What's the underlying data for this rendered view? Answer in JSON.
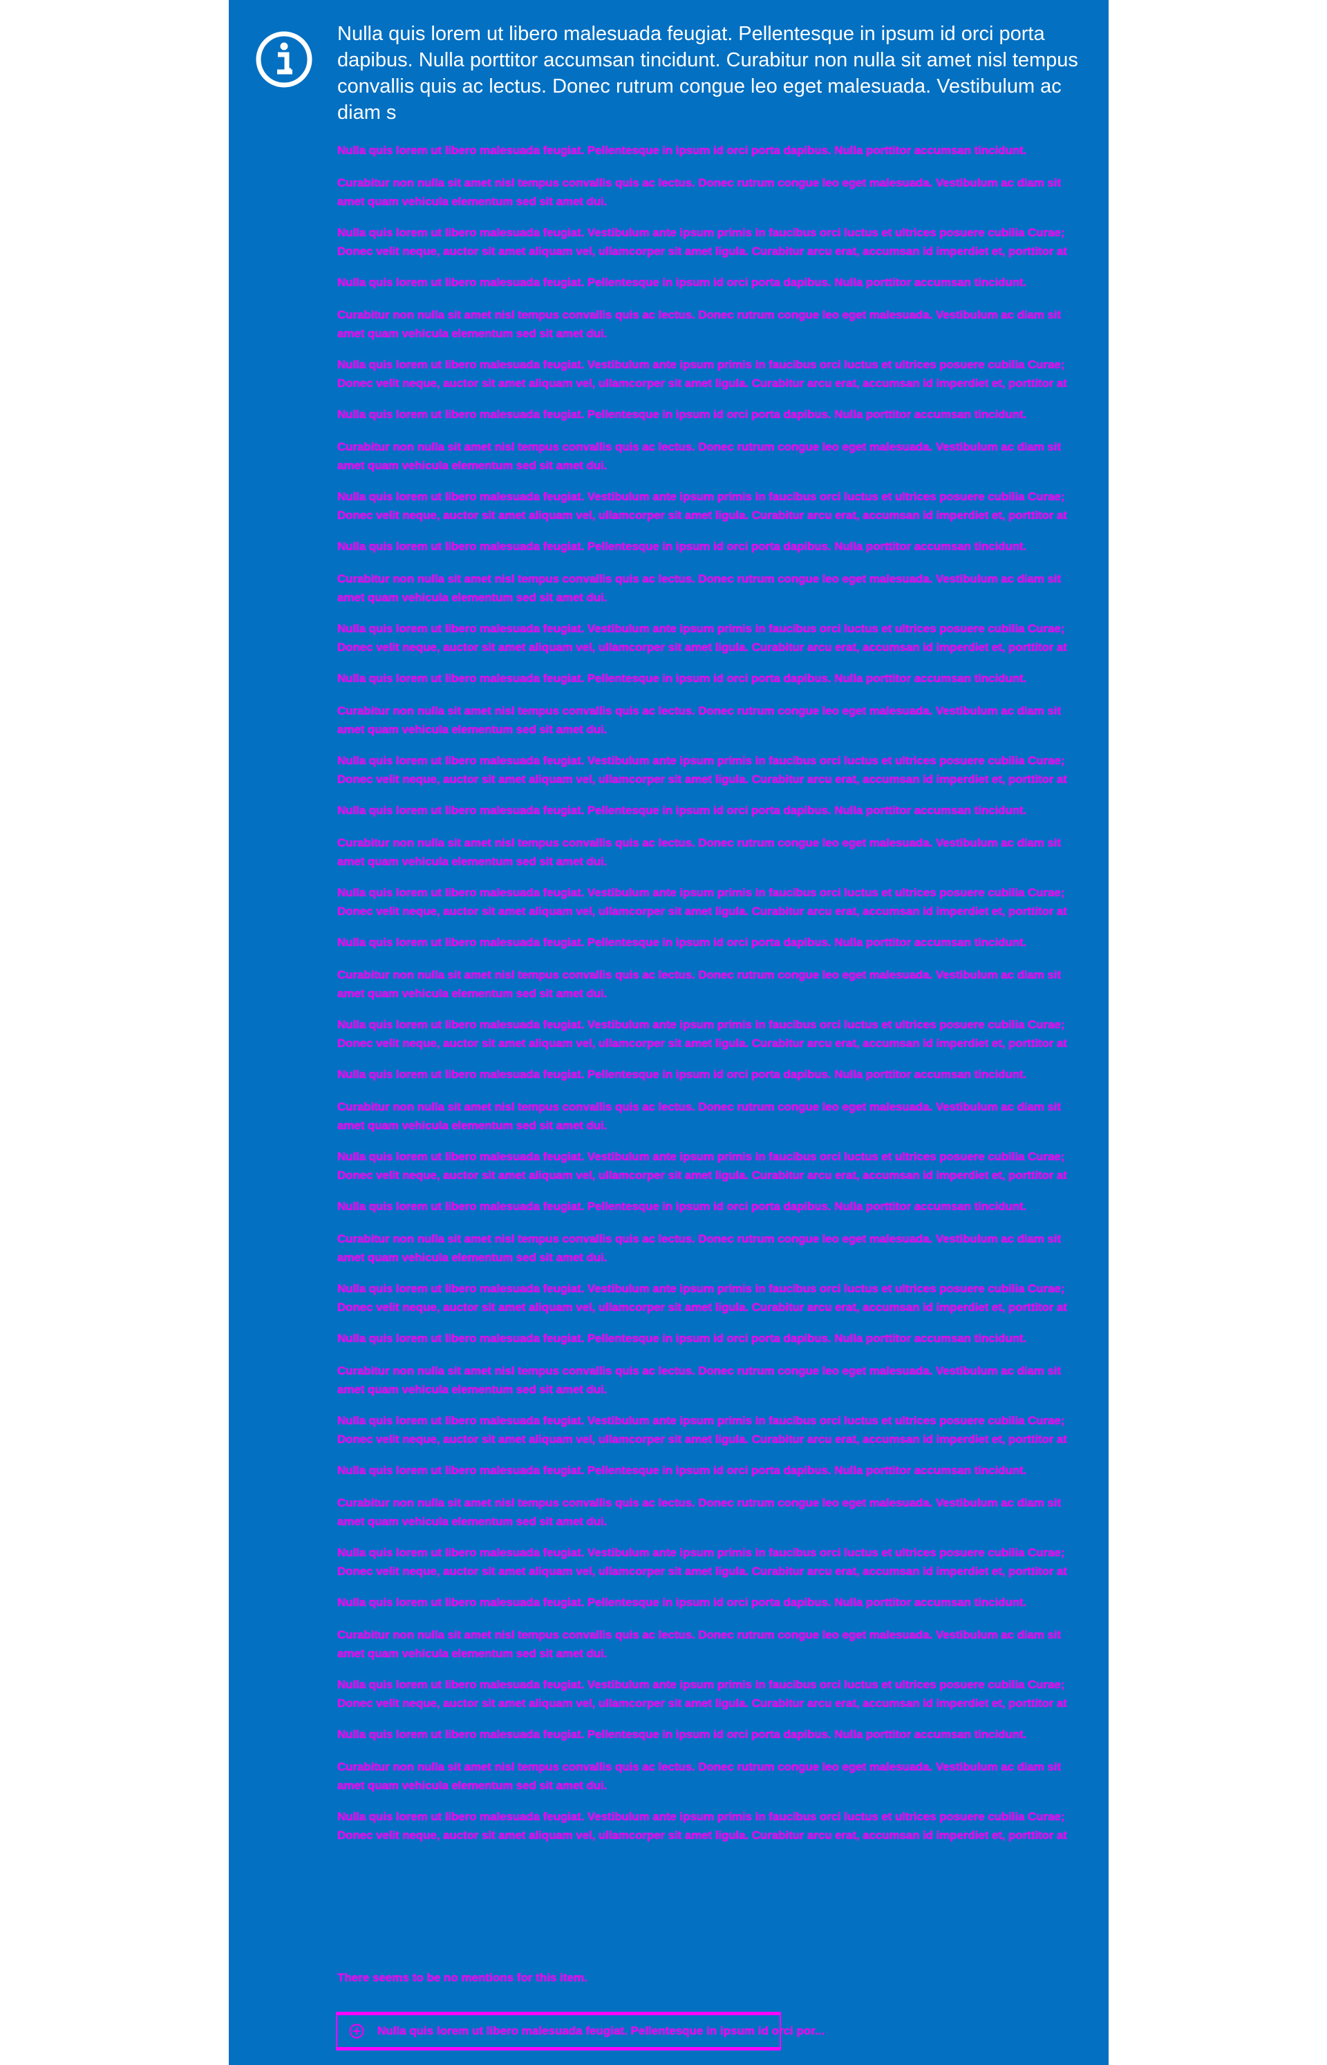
{
  "colors": {
    "panel_background": "#0370c2",
    "lead_text": "#ffffff",
    "note_text": "#ee00ee",
    "outline": "#ff00ff"
  },
  "info_box": {
    "icon": "info-circle-icon",
    "lead_text": "Nulla quis lorem ut libero malesuada feugiat. Pellentesque in ipsum id orci porta dapibus. Nulla porttitor accumsan tincidunt. Curabitur non nulla sit amet nisl tempus convallis quis ac lectus. Donec rutrum congue leo eget malesuada. Vestibulum ac diam s"
  },
  "notes": [
    "Nulla quis lorem ut libero malesuada feugiat. Pellentesque in ipsum id orci porta dapibus. Nulla porttitor accumsan tincidunt.",
    "Curabitur non nulla sit amet nisl tempus convallis quis ac lectus. Donec rutrum congue leo eget malesuada. Vestibulum ac diam sit amet quam vehicula elementum sed sit amet dui.",
    "Nulla quis lorem ut libero malesuada feugiat. Vestibulum ante ipsum primis in faucibus orci luctus et ultrices posuere cubilia Curae; Donec velit neque, auctor sit amet aliquam vel, ullamcorper sit amet ligula. Curabitur arcu erat, accumsan id imperdiet et, porttitor at sem.",
    "Nulla quis lorem ut libero malesuada feugiat. Pellentesque in ipsum id orci porta dapibus. Nulla porttitor accumsan tincidunt.",
    "Curabitur non nulla sit amet nisl tempus convallis quis ac lectus. Donec rutrum congue leo eget malesuada. Vestibulum ac diam sit amet quam vehicula elementum sed sit amet dui.",
    "Nulla quis lorem ut libero malesuada feugiat. Vestibulum ante ipsum primis in faucibus orci luctus et ultrices posuere cubilia Curae; Donec velit neque, auctor sit amet aliquam vel, ullamcorper sit amet ligula. Curabitur arcu erat, accumsan id imperdiet et, porttitor at sem.",
    "Nulla quis lorem ut libero malesuada feugiat. Pellentesque in ipsum id orci porta dapibus. Nulla porttitor accumsan tincidunt.",
    "Curabitur non nulla sit amet nisl tempus convallis quis ac lectus. Donec rutrum congue leo eget malesuada. Vestibulum ac diam sit amet quam vehicula elementum sed sit amet dui.",
    "Nulla quis lorem ut libero malesuada feugiat. Vestibulum ante ipsum primis in faucibus orci luctus et ultrices posuere cubilia Curae; Donec velit neque, auctor sit amet aliquam vel, ullamcorper sit amet ligula. Curabitur arcu erat, accumsan id imperdiet et, porttitor at sem.",
    "Nulla quis lorem ut libero malesuada feugiat. Pellentesque in ipsum id orci porta dapibus. Nulla porttitor accumsan tincidunt.",
    "Curabitur non nulla sit amet nisl tempus convallis quis ac lectus. Donec rutrum congue leo eget malesuada. Vestibulum ac diam sit amet quam vehicula elementum sed sit amet dui.",
    "Nulla quis lorem ut libero malesuada feugiat. Vestibulum ante ipsum primis in faucibus orci luctus et ultrices posuere cubilia Curae; Donec velit neque, auctor sit amet aliquam vel, ullamcorper sit amet ligula. Curabitur arcu erat, accumsan id imperdiet et, porttitor at sem.",
    "Nulla quis lorem ut libero malesuada feugiat. Pellentesque in ipsum id orci porta dapibus. Nulla porttitor accumsan tincidunt.",
    "Curabitur non nulla sit amet nisl tempus convallis quis ac lectus. Donec rutrum congue leo eget malesuada. Vestibulum ac diam sit amet quam vehicula elementum sed sit amet dui.",
    "Nulla quis lorem ut libero malesuada feugiat. Vestibulum ante ipsum primis in faucibus orci luctus et ultrices posuere cubilia Curae; Donec velit neque, auctor sit amet aliquam vel, ullamcorper sit amet ligula. Curabitur arcu erat, accumsan id imperdiet et, porttitor at sem.",
    "Nulla quis lorem ut libero malesuada feugiat. Pellentesque in ipsum id orci porta dapibus. Nulla porttitor accumsan tincidunt.",
    "Curabitur non nulla sit amet nisl tempus convallis quis ac lectus. Donec rutrum congue leo eget malesuada. Vestibulum ac diam sit amet quam vehicula elementum sed sit amet dui.",
    "Nulla quis lorem ut libero malesuada feugiat. Vestibulum ante ipsum primis in faucibus orci luctus et ultrices posuere cubilia Curae; Donec velit neque, auctor sit amet aliquam vel, ullamcorper sit amet ligula. Curabitur arcu erat, accumsan id imperdiet et, porttitor at sem.",
    "Nulla quis lorem ut libero malesuada feugiat. Pellentesque in ipsum id orci porta dapibus. Nulla porttitor accumsan tincidunt.",
    "Curabitur non nulla sit amet nisl tempus convallis quis ac lectus. Donec rutrum congue leo eget malesuada. Vestibulum ac diam sit amet quam vehicula elementum sed sit amet dui.",
    "Nulla quis lorem ut libero malesuada feugiat. Vestibulum ante ipsum primis in faucibus orci luctus et ultrices posuere cubilia Curae; Donec velit neque, auctor sit amet aliquam vel, ullamcorper sit amet ligula. Curabitur arcu erat, accumsan id imperdiet et, porttitor at sem.",
    "Nulla quis lorem ut libero malesuada feugiat. Pellentesque in ipsum id orci porta dapibus. Nulla porttitor accumsan tincidunt.",
    "Curabitur non nulla sit amet nisl tempus convallis quis ac lectus. Donec rutrum congue leo eget malesuada. Vestibulum ac diam sit amet quam vehicula elementum sed sit amet dui.",
    "Nulla quis lorem ut libero malesuada feugiat. Vestibulum ante ipsum primis in faucibus orci luctus et ultrices posuere cubilia Curae; Donec velit neque, auctor sit amet aliquam vel, ullamcorper sit amet ligula. Curabitur arcu erat, accumsan id imperdiet et, porttitor at sem.",
    "Nulla quis lorem ut libero malesuada feugiat. Pellentesque in ipsum id orci porta dapibus. Nulla porttitor accumsan tincidunt.",
    "Curabitur non nulla sit amet nisl tempus convallis quis ac lectus. Donec rutrum congue leo eget malesuada. Vestibulum ac diam sit amet quam vehicula elementum sed sit amet dui.",
    "Nulla quis lorem ut libero malesuada feugiat. Vestibulum ante ipsum primis in faucibus orci luctus et ultrices posuere cubilia Curae; Donec velit neque, auctor sit amet aliquam vel, ullamcorper sit amet ligula. Curabitur arcu erat, accumsan id imperdiet et, porttitor at sem.",
    "Nulla quis lorem ut libero malesuada feugiat. Pellentesque in ipsum id orci porta dapibus. Nulla porttitor accumsan tincidunt.",
    "Curabitur non nulla sit amet nisl tempus convallis quis ac lectus. Donec rutrum congue leo eget malesuada. Vestibulum ac diam sit amet quam vehicula elementum sed sit amet dui.",
    "Nulla quis lorem ut libero malesuada feugiat. Vestibulum ante ipsum primis in faucibus orci luctus et ultrices posuere cubilia Curae; Donec velit neque, auctor sit amet aliquam vel, ullamcorper sit amet ligula. Curabitur arcu erat, accumsan id imperdiet et, porttitor at sem.",
    "Nulla quis lorem ut libero malesuada feugiat. Pellentesque in ipsum id orci porta dapibus. Nulla porttitor accumsan tincidunt.",
    "Curabitur non nulla sit amet nisl tempus convallis quis ac lectus. Donec rutrum congue leo eget malesuada. Vestibulum ac diam sit amet quam vehicula elementum sed sit amet dui.",
    "Nulla quis lorem ut libero malesuada feugiat. Vestibulum ante ipsum primis in faucibus orci luctus et ultrices posuere cubilia Curae; Donec velit neque, auctor sit amet aliquam vel, ullamcorper sit amet ligula. Curabitur arcu erat, accumsan id imperdiet et, porttitor at sem.",
    "Nulla quis lorem ut libero malesuada feugiat. Pellentesque in ipsum id orci porta dapibus. Nulla porttitor accumsan tincidunt.",
    "Curabitur non nulla sit amet nisl tempus convallis quis ac lectus. Donec rutrum congue leo eget malesuada. Vestibulum ac diam sit amet quam vehicula elementum sed sit amet dui.",
    "Nulla quis lorem ut libero malesuada feugiat. Vestibulum ante ipsum primis in faucibus orci luctus et ultrices posuere cubilia Curae; Donec velit neque, auctor sit amet aliquam vel, ullamcorper sit amet ligula. Curabitur arcu erat, accumsan id imperdiet et, porttitor at sem.",
    "Nulla quis lorem ut libero malesuada feugiat. Pellentesque in ipsum id orci porta dapibus. Nulla porttitor accumsan tincidunt.",
    "Curabitur non nulla sit amet nisl tempus convallis quis ac lectus. Donec rutrum congue leo eget malesuada. Vestibulum ac diam sit amet quam vehicula elementum sed sit amet dui.",
    "Nulla quis lorem ut libero malesuada feugiat. Vestibulum ante ipsum primis in faucibus orci luctus et ultrices posuere cubilia Curae; Donec velit neque, auctor sit amet aliquam vel, ullamcorper sit amet ligula. Curabitur arcu erat, accumsan id imperdiet et, porttitor at sem."
  ],
  "empty_message": "There seems to be no mentions for this item.",
  "link_button": {
    "icon": "add-circle-icon",
    "label": "Nulla quis lorem ut libero malesuada feugiat. Pellentesque in ipsum id orci por..."
  }
}
